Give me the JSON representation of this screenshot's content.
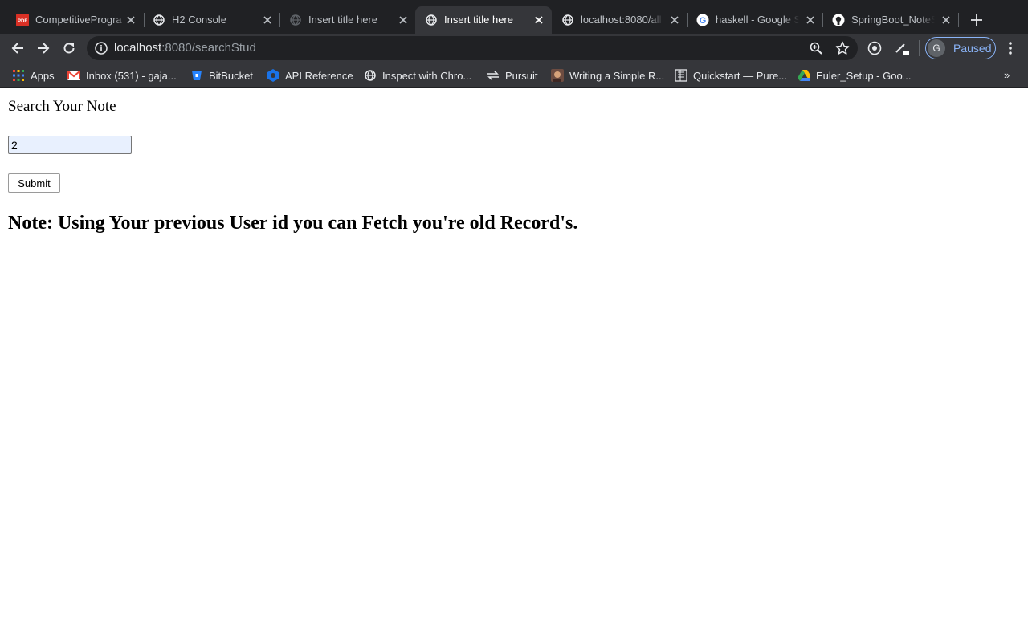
{
  "browser": {
    "tabs": [
      {
        "title": "CompetitiveProgra",
        "favicon": "pdf-icon",
        "active": false
      },
      {
        "title": "H2 Console",
        "favicon": "globe-icon",
        "active": false
      },
      {
        "title": "Insert title here",
        "favicon": "globe-icon",
        "active": false
      },
      {
        "title": "Insert title here",
        "favicon": "globe-icon",
        "active": true
      },
      {
        "title": "localhost:8080/all",
        "favicon": "globe-icon",
        "active": false
      },
      {
        "title": "haskell - Google S",
        "favicon": "google-icon",
        "active": false
      },
      {
        "title": "SpringBoot_NoteS",
        "favicon": "github-icon",
        "active": false
      }
    ],
    "url": {
      "host": "localhost",
      "path": ":8080/searchStud"
    },
    "profile": {
      "initial": "G",
      "status": "Paused"
    },
    "bookmarks": [
      {
        "label": "Apps",
        "icon": "apps-grid-icon"
      },
      {
        "label": "Inbox (531) - gaja...",
        "icon": "gmail-icon"
      },
      {
        "label": "BitBucket",
        "icon": "bitbucket-icon"
      },
      {
        "label": "API Reference",
        "icon": "api-icon"
      },
      {
        "label": "Inspect with Chro...",
        "icon": "globe-icon"
      },
      {
        "label": "Pursuit",
        "icon": "pursuit-icon"
      },
      {
        "label": "Writing a Simple R...",
        "icon": "avatar-icon"
      },
      {
        "label": "Quickstart — Pure...",
        "icon": "doc-icon"
      },
      {
        "label": "Euler_Setup - Goo...",
        "icon": "drive-icon"
      }
    ],
    "bookmarks_more": "»"
  },
  "page": {
    "heading": "Search Your Note",
    "search_value": "2",
    "submit_label": "Submit",
    "note": "Note: Using Your previous User id you can Fetch you're old Record's."
  },
  "colors": {
    "tabstrip": "#202124",
    "toolbar": "#35363a",
    "omnibox": "#202124",
    "accent": "#8ab4f8"
  }
}
